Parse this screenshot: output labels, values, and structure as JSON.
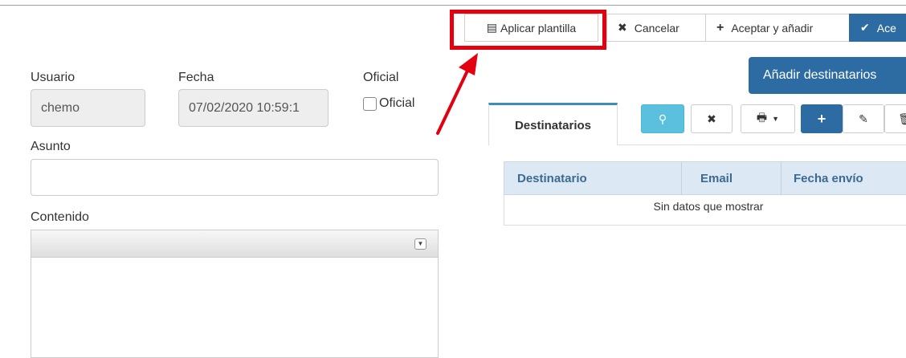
{
  "toolbar": {
    "apply_template": "Aplicar plantilla",
    "cancel": "Cancelar",
    "accept_add": "Aceptar y añadir",
    "accept": "Ace"
  },
  "form": {
    "user_label": "Usuario",
    "user_value": "chemo",
    "date_label": "Fecha",
    "date_value": "07/02/2020 10:59:1",
    "official_label": "Oficial",
    "official_checkbox_label": "Oficial",
    "subject_label": "Asunto",
    "subject_value": "",
    "content_label": "Contenido"
  },
  "recipients": {
    "add_button": "Añadir destinatarios",
    "tab_label": "Destinatarios",
    "columns": [
      "Destinatario",
      "Email",
      "Fecha envío"
    ],
    "empty_message": "Sin datos que mostrar"
  },
  "colors": {
    "primary": "#2d6ca2",
    "info": "#5bc0de",
    "highlight": "#e3000f",
    "grid_header": "#dce9f5"
  }
}
